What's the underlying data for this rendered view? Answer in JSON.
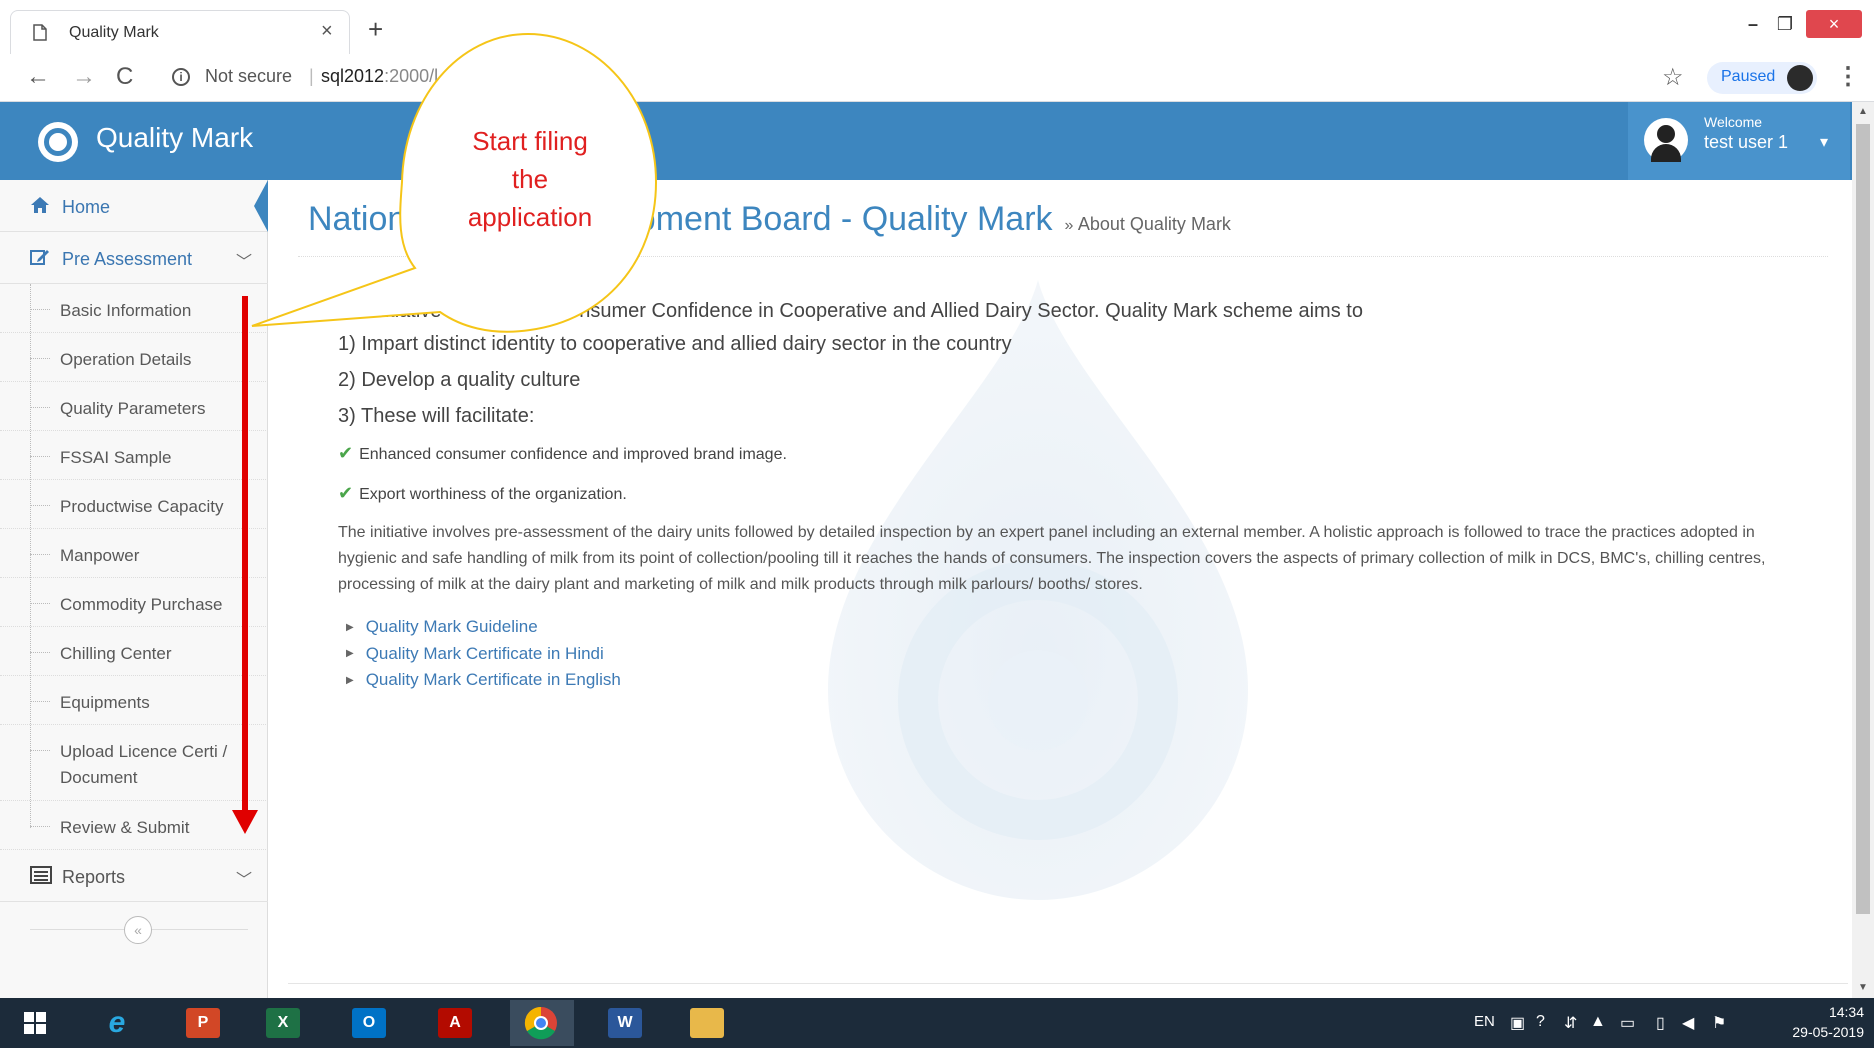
{
  "browser": {
    "tab_title": "Quality Mark",
    "tab_close": "×",
    "new_tab": "+",
    "not_secure": "Not secure",
    "url_host": "sql2012",
    "url_rest": ":2000/l",
    "paused_label": "Paused",
    "window_min": "–",
    "window_max": "❐",
    "window_close": "×",
    "back": "←",
    "forward": "→",
    "reload": "C",
    "star": "☆",
    "menu": "⋮"
  },
  "app": {
    "title": "Quality Mark",
    "user": {
      "welcome": "Welcome",
      "name": "test user 1",
      "caret": "▾"
    }
  },
  "sidebar": {
    "home": {
      "label": "Home",
      "icon": "home-icon"
    },
    "pre_assessment": {
      "label": "Pre Assessment",
      "icon": "edit-icon"
    },
    "sub_items": [
      {
        "label": "Basic Information"
      },
      {
        "label": "Operation Details"
      },
      {
        "label": "Quality Parameters"
      },
      {
        "label": "FSSAI Sample"
      },
      {
        "label": "Productwise Capacity"
      },
      {
        "label": "Manpower"
      },
      {
        "label": "Commodity Purchase"
      },
      {
        "label": "Chilling Center"
      },
      {
        "label": "Equipments"
      },
      {
        "label": "Upload Licence Certi / Document"
      },
      {
        "label": "Review & Submit"
      }
    ],
    "reports": {
      "label": "Reports",
      "icon": "list-icon"
    },
    "collapse": "«"
  },
  "main": {
    "title": "National Dairy Development Board - Quality Mark",
    "breadcrumb_sep": "»",
    "breadcrumb": "About Quality Mark",
    "intro": "An Initiative to Enhance Consumer Confidence in Cooperative and Allied Dairy Sector. Quality Mark scheme aims to",
    "points": [
      "1) Impart distinct identity to cooperative and allied dairy sector in the country",
      "2) Develop a quality culture",
      "3) These will facilitate:"
    ],
    "benefits": [
      "Enhanced consumer confidence and improved brand image.",
      "Export worthiness of the organization."
    ],
    "paragraph": "The initiative involves pre-assessment of the dairy units followed by detailed inspection by an expert panel including an external member. A holistic approach is followed to trace the practices adopted in hygienic and safe handling of milk from its point of collection/pooling till it reaches the hands of consumers. The inspection covers the aspects of primary collection of milk in DCS, BMC's, chilling centres, processing of milk at the dairy plant and marketing of milk and milk products through milk parlours/ booths/ stores.",
    "links": [
      "Quality Mark Guideline",
      "Quality Mark Certificate in Hindi",
      "Quality Mark Certificate in English"
    ]
  },
  "annotation": {
    "callout_line1": "Start filing",
    "callout_line2": "the",
    "callout_line3": "application",
    "bubble_color": "#f5c518",
    "arrow_color": "#e00000"
  },
  "taskbar": {
    "apps": [
      {
        "name": "internet-explorer",
        "glyph": "e"
      },
      {
        "name": "powerpoint",
        "glyph": "P"
      },
      {
        "name": "excel",
        "glyph": "X"
      },
      {
        "name": "outlook",
        "glyph": "O"
      },
      {
        "name": "acrobat",
        "glyph": "A"
      },
      {
        "name": "chrome",
        "glyph": ""
      },
      {
        "name": "word",
        "glyph": "W"
      },
      {
        "name": "file-explorer",
        "glyph": ""
      }
    ],
    "language": "EN",
    "time": "14:34",
    "date": "29-05-2019"
  },
  "colors": {
    "header": "#3d86bf",
    "link": "#3d7ab5",
    "check": "#4aa54a",
    "taskbar": "#1c2b3a"
  }
}
